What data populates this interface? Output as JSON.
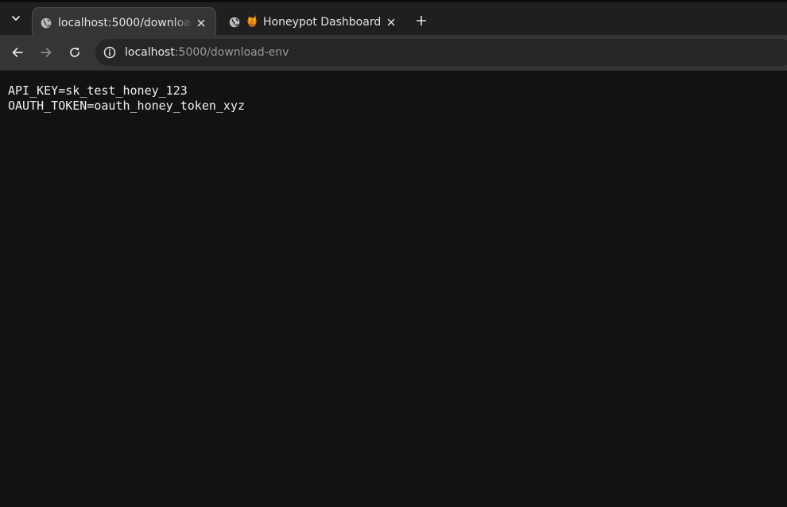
{
  "tabs": [
    {
      "title": "localhost:5000/download-env",
      "active": true,
      "favicon": "globe-icon"
    },
    {
      "title": "Honeypot Dashboard",
      "active": false,
      "favicon": "globe-icon",
      "emoji": "🍯"
    }
  ],
  "address_bar": {
    "host": "localhost",
    "rest": ":5000/download-env"
  },
  "content": {
    "lines": [
      "API_KEY=sk_test_honey_123",
      "OAUTH_TOKEN=oauth_honey_token_xyz"
    ]
  },
  "colors": {
    "page_background": "#121212",
    "tabstrip": "#1f1f1f",
    "toolbar": "#353535",
    "omnibox": "#262626",
    "text": "#f0f0f0"
  }
}
